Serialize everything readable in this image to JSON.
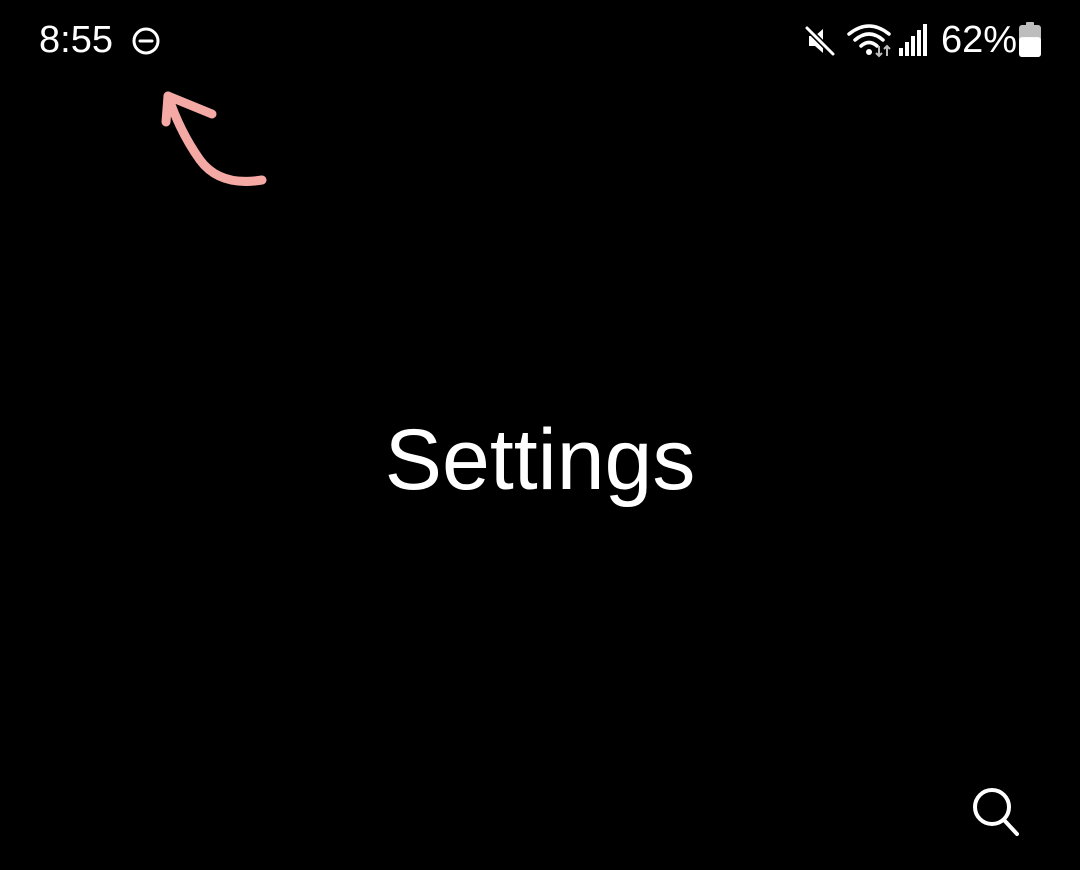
{
  "status_bar": {
    "time": "8:55",
    "battery_percent": "62%",
    "battery_level": 0.62,
    "icons": [
      "do-not-disturb-icon",
      "mute-icon",
      "wifi-icon",
      "signal-icon",
      "battery-icon"
    ]
  },
  "header": {
    "title": "Settings"
  },
  "actions": {
    "search_icon": "search-icon"
  },
  "annotation": {
    "arrow_color": "#f4a9a4"
  },
  "colors": {
    "background": "#000000",
    "text": "#ffffff"
  }
}
